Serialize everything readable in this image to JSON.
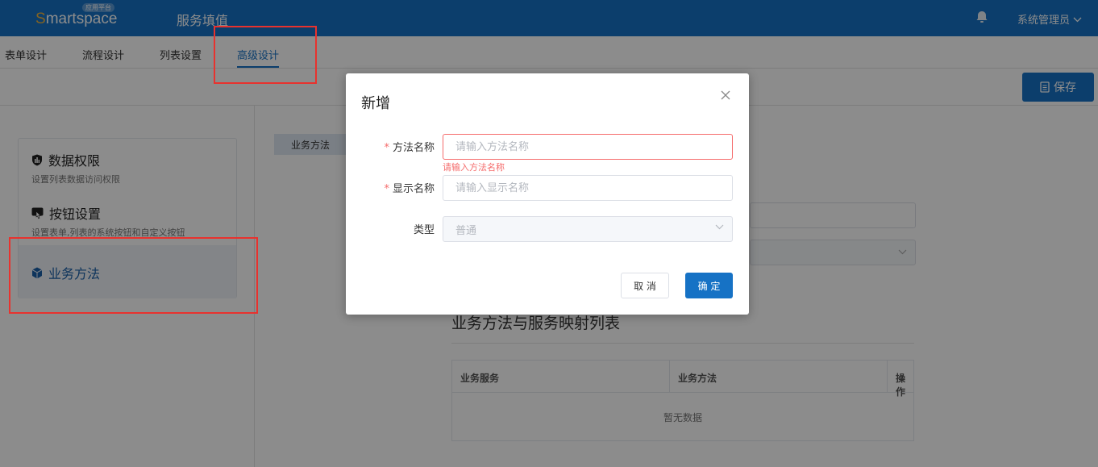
{
  "header": {
    "logo_first": "S",
    "logo_rest": "martspace",
    "logo_badge": "应用平台",
    "app_title": "服务填值",
    "user": "系统管理员"
  },
  "tabs": [
    {
      "label": "表单设计",
      "active": false
    },
    {
      "label": "流程设计",
      "active": false
    },
    {
      "label": "列表设置",
      "active": false
    },
    {
      "label": "高级设计",
      "active": true
    }
  ],
  "toolbar": {
    "save_label": "保存"
  },
  "left_menu": [
    {
      "title": "数据权限",
      "desc": "设置列表数据访问权限",
      "icon": "shield-icon"
    },
    {
      "title": "按钮设置",
      "desc": "设置表单,列表的系统按钮和自定义按钮",
      "icon": "hand-pointer-icon"
    },
    {
      "title": "业务方法",
      "desc": "",
      "icon": "cube-icon",
      "active": true
    }
  ],
  "main": {
    "subtab": "业务方法",
    "section_title": "业务方法与服务映射列表",
    "table": {
      "columns": [
        "业务服务",
        "业务方法",
        "操作"
      ],
      "empty_text": "暂无数据"
    }
  },
  "dialog": {
    "title": "新增",
    "fields": {
      "method_name": {
        "label": "方法名称",
        "placeholder": "请输入方法名称",
        "error": "请输入方法名称",
        "required": true
      },
      "display_name": {
        "label": "显示名称",
        "placeholder": "请输入显示名称",
        "required": true
      },
      "type": {
        "label": "类型",
        "value": "普通",
        "required": false
      }
    },
    "cancel_label": "取 消",
    "ok_label": "确 定"
  },
  "colors": {
    "primary": "#1672c5",
    "error": "#f56c6c",
    "annotation": "#e8322e"
  }
}
